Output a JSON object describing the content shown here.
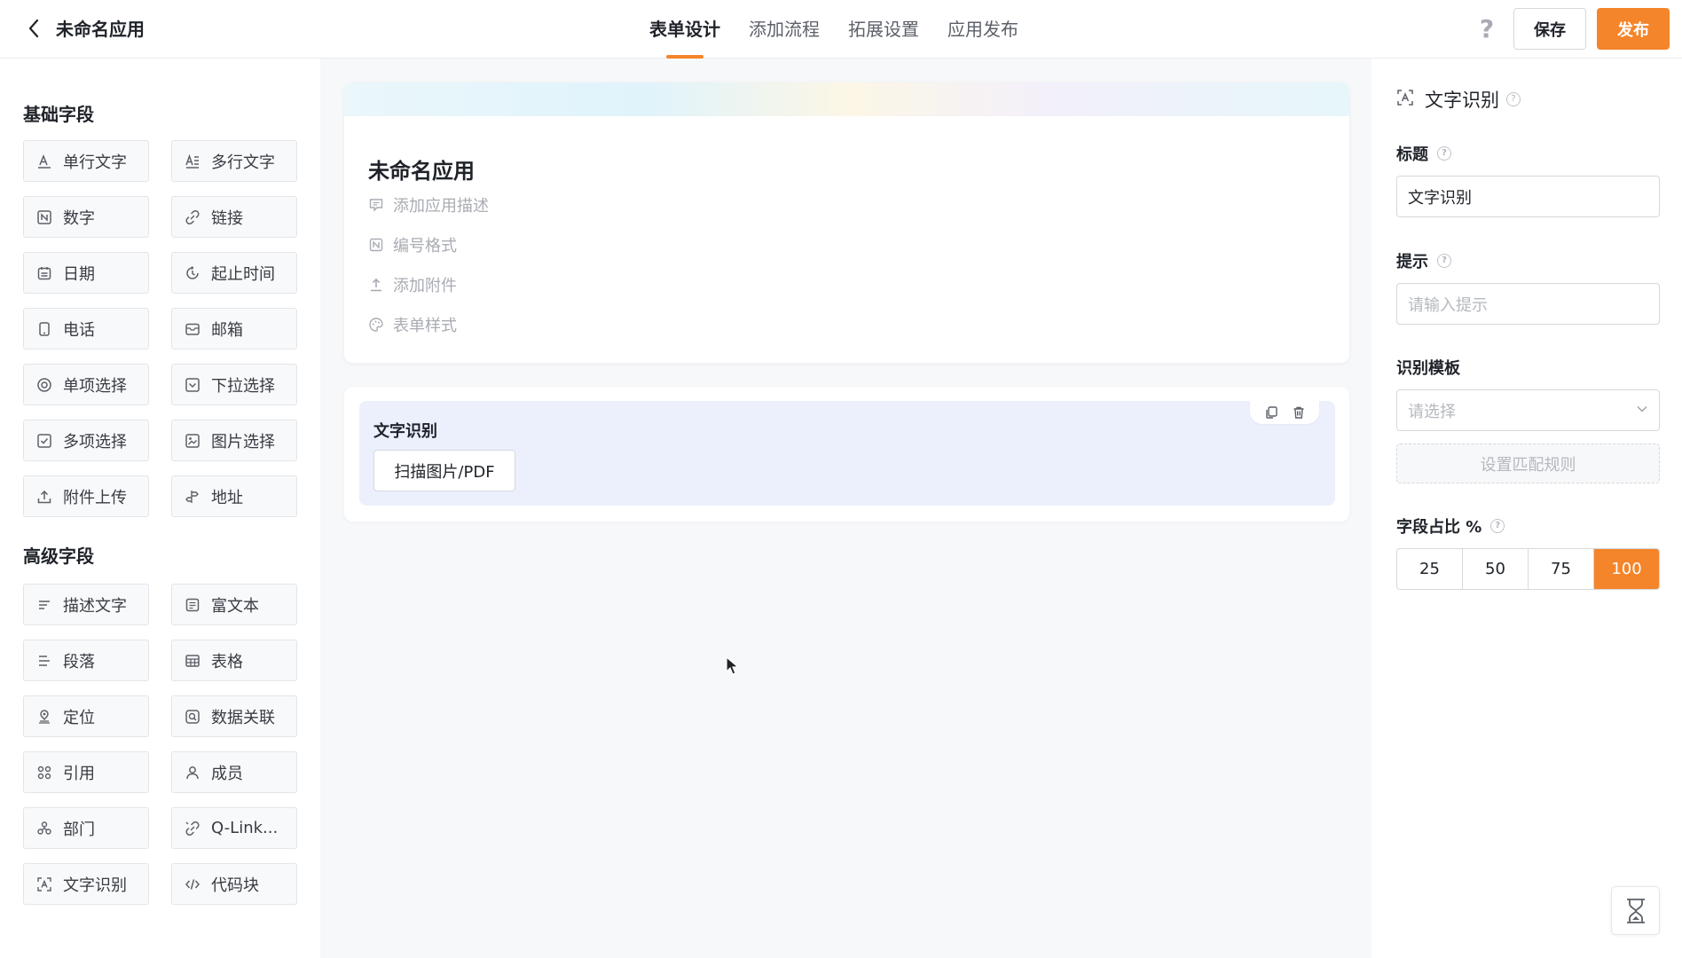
{
  "header": {
    "app_name": "未命名应用",
    "tabs": [
      {
        "label": "表单设计",
        "active": true
      },
      {
        "label": "添加流程",
        "active": false
      },
      {
        "label": "拓展设置",
        "active": false
      },
      {
        "label": "应用发布",
        "active": false
      }
    ],
    "help": "?",
    "save_label": "保存",
    "publish_label": "发布",
    "accent_color": "#f5852a"
  },
  "left_panel": {
    "basic_title": "基础字段",
    "basic_fields": [
      {
        "label": "单行文字",
        "icon": "single-line-text-icon"
      },
      {
        "label": "多行文字",
        "icon": "multi-line-text-icon"
      },
      {
        "label": "数字",
        "icon": "number-icon"
      },
      {
        "label": "链接",
        "icon": "link-icon"
      },
      {
        "label": "日期",
        "icon": "calendar-icon"
      },
      {
        "label": "起止时间",
        "icon": "time-range-icon"
      },
      {
        "label": "电话",
        "icon": "phone-icon"
      },
      {
        "label": "邮箱",
        "icon": "mail-icon"
      },
      {
        "label": "单项选择",
        "icon": "radio-icon"
      },
      {
        "label": "下拉选择",
        "icon": "dropdown-icon"
      },
      {
        "label": "多项选择",
        "icon": "checkbox-icon"
      },
      {
        "label": "图片选择",
        "icon": "image-icon"
      },
      {
        "label": "附件上传",
        "icon": "upload-icon"
      },
      {
        "label": "地址",
        "icon": "address-icon"
      }
    ],
    "advanced_title": "高级字段",
    "advanced_fields": [
      {
        "label": "描述文字",
        "icon": "description-icon"
      },
      {
        "label": "富文本",
        "icon": "rich-text-icon"
      },
      {
        "label": "段落",
        "icon": "paragraph-icon"
      },
      {
        "label": "表格",
        "icon": "table-icon"
      },
      {
        "label": "定位",
        "icon": "location-icon"
      },
      {
        "label": "数据关联",
        "icon": "data-link-icon"
      },
      {
        "label": "引用",
        "icon": "reference-icon"
      },
      {
        "label": "成员",
        "icon": "member-icon"
      },
      {
        "label": "部门",
        "icon": "department-icon"
      },
      {
        "label": "Q-Link...",
        "icon": "qlink-icon"
      },
      {
        "label": "文字识别",
        "icon": "ocr-icon"
      },
      {
        "label": "代码块",
        "icon": "code-icon"
      }
    ]
  },
  "canvas": {
    "form_title": "未命名应用",
    "meta_items": [
      {
        "label": "添加应用描述",
        "icon": "comment-icon"
      },
      {
        "label": "编号格式",
        "icon": "number-format-icon"
      },
      {
        "label": "添加附件",
        "icon": "upload-icon"
      },
      {
        "label": "表单样式",
        "icon": "palette-icon"
      }
    ],
    "field": {
      "label": "文字识别",
      "scan_button": "扫描图片/PDF"
    }
  },
  "right_panel": {
    "title": "文字识别",
    "title_label": "标题",
    "title_value": "文字识别",
    "hint_label": "提示",
    "hint_placeholder": "请输入提示",
    "template_label": "识别模板",
    "template_placeholder": "请选择",
    "match_rule_button": "设置匹配规则",
    "ratio_label": "字段占比 %",
    "ratio_options": [
      "25",
      "50",
      "75",
      "100"
    ],
    "ratio_selected": "100"
  }
}
